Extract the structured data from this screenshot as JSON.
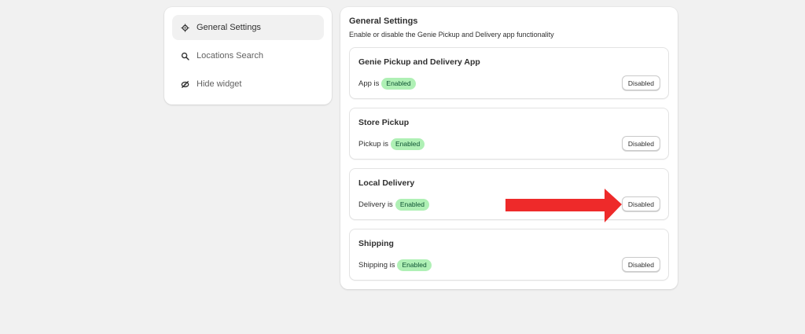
{
  "sidebar": {
    "items": [
      {
        "label": "General Settings",
        "icon": "gear-icon",
        "active": true
      },
      {
        "label": "Locations Search",
        "icon": "search-icon",
        "active": false
      },
      {
        "label": "Hide widget",
        "icon": "hide-icon",
        "active": false
      }
    ]
  },
  "main": {
    "title": "General Settings",
    "subtitle": "Enable or disable the Genie Pickup and Delivery app functionality",
    "sections": [
      {
        "title": "Genie Pickup and Delivery App",
        "status_prefix": "App is",
        "status": "Enabled",
        "button": "Disabled"
      },
      {
        "title": "Store Pickup",
        "status_prefix": "Pickup is",
        "status": "Enabled",
        "button": "Disabled"
      },
      {
        "title": "Local Delivery",
        "status_prefix": "Delivery is",
        "status": "Enabled",
        "button": "Disabled"
      },
      {
        "title": "Shipping",
        "status_prefix": "Shipping is",
        "status": "Enabled",
        "button": "Disabled"
      }
    ]
  },
  "colors": {
    "badge_bg": "#aff0b5",
    "badge_text": "#0c5132",
    "annotation_arrow": "#ee2a2a"
  }
}
